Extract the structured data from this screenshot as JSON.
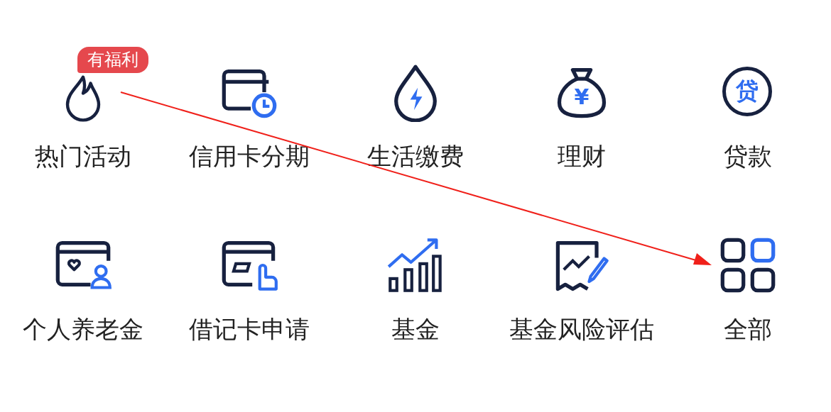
{
  "rows": [
    [
      {
        "label": "热门活动",
        "badge": "有福利"
      },
      {
        "label": "信用卡分期"
      },
      {
        "label": "生活缴费"
      },
      {
        "label": "理财",
        "icon_glyph": "¥"
      },
      {
        "label": "贷款",
        "icon_glyph": "贷"
      }
    ],
    [
      {
        "label": "个人养老金"
      },
      {
        "label": "借记卡申请"
      },
      {
        "label": "基金"
      },
      {
        "label": "基金风险评估"
      },
      {
        "label": "全部"
      }
    ]
  ]
}
